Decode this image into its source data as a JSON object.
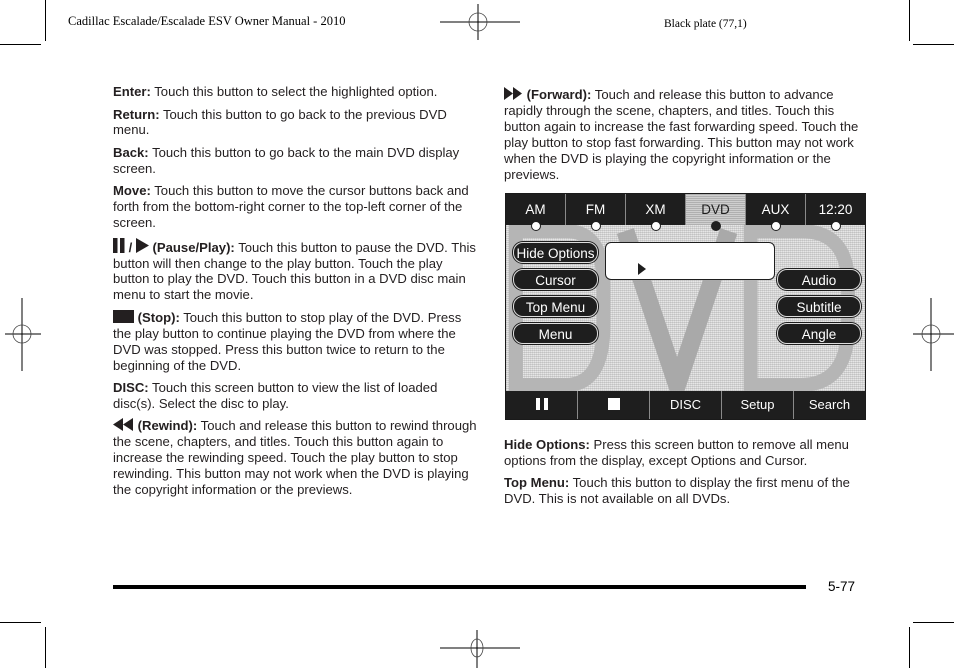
{
  "header": {
    "manual_title": "Cadillac Escalade/Escalade ESV Owner Manual - 2010",
    "plate": "Black plate (77,1)"
  },
  "left_column": {
    "entries": [
      {
        "term": "Enter:",
        "text": " Touch this button to select the highlighted option."
      },
      {
        "term": "Return:",
        "text": " Touch this button to go back to the previous DVD menu."
      },
      {
        "term": "Back:",
        "text": " Touch this button to go back to the main DVD display screen."
      },
      {
        "term": "Move:",
        "text": " Touch this button to move the cursor buttons back and forth from the bottom-right corner to the top-left corner of the screen."
      },
      {
        "icon": "pause-play-icon",
        "separator": " / ",
        "term": " (Pause/Play):",
        "text": " Touch this button to pause the DVD. This button will then change to the play button. Touch the play button to play the DVD. Touch this button in a DVD disc main menu to start the movie."
      },
      {
        "icon": "stop-icon",
        "term": " (Stop):",
        "text": " Touch this button to stop play of the DVD. Press the play button to continue playing the DVD from where the DVD was stopped. Press this button twice to return to the beginning of the DVD."
      },
      {
        "term": "DISC:",
        "text": " Touch this screen button to view the list of loaded disc(s). Select the disc to play."
      },
      {
        "icon": "rewind-icon",
        "term": " (Rewind):",
        "text": "  Touch and release this button to rewind through the scene, chapters, and titles. Touch this button again to increase the rewinding speed. Touch the play button to stop rewinding. This button may not work when the DVD is playing the copyright information or the previews."
      }
    ]
  },
  "right_column": {
    "forward": {
      "icon": "forward-icon",
      "term": " (Forward):",
      "text": " Touch and release this button to advance rapidly through the scene, chapters, and titles. Touch this button again to increase the fast forwarding speed. Touch the play button to stop fast forwarding. This button may not work when the DVD is playing the copyright information or the previews."
    },
    "after_screen": [
      {
        "term": "Hide Options:",
        "text": " Press this screen button to remove all menu options from the display, except Options and Cursor."
      },
      {
        "term": "Top Menu:",
        "text": " Touch this button to display the first menu of the DVD. This is not available on all DVDs."
      }
    ]
  },
  "dvd_screen": {
    "top_tabs": [
      {
        "label": "AM",
        "active": false
      },
      {
        "label": "FM",
        "active": false
      },
      {
        "label": "XM",
        "active": false
      },
      {
        "label": "DVD",
        "active": true
      },
      {
        "label": "AUX",
        "active": false
      },
      {
        "label": "12:20",
        "active": false
      }
    ],
    "left_buttons": [
      "Hide Options",
      "Cursor",
      "Top Menu",
      "Menu"
    ],
    "right_buttons": [
      "Audio",
      "Subtitle",
      "Angle"
    ],
    "background_text": "DVD",
    "bottom_buttons": [
      {
        "icon": "pause-icon",
        "label": ""
      },
      {
        "icon": "stop-icon",
        "label": ""
      },
      {
        "icon": "",
        "label": "DISC"
      },
      {
        "icon": "",
        "label": "Setup"
      },
      {
        "icon": "",
        "label": "Search"
      }
    ]
  },
  "footer": {
    "page_number": "5-77"
  }
}
